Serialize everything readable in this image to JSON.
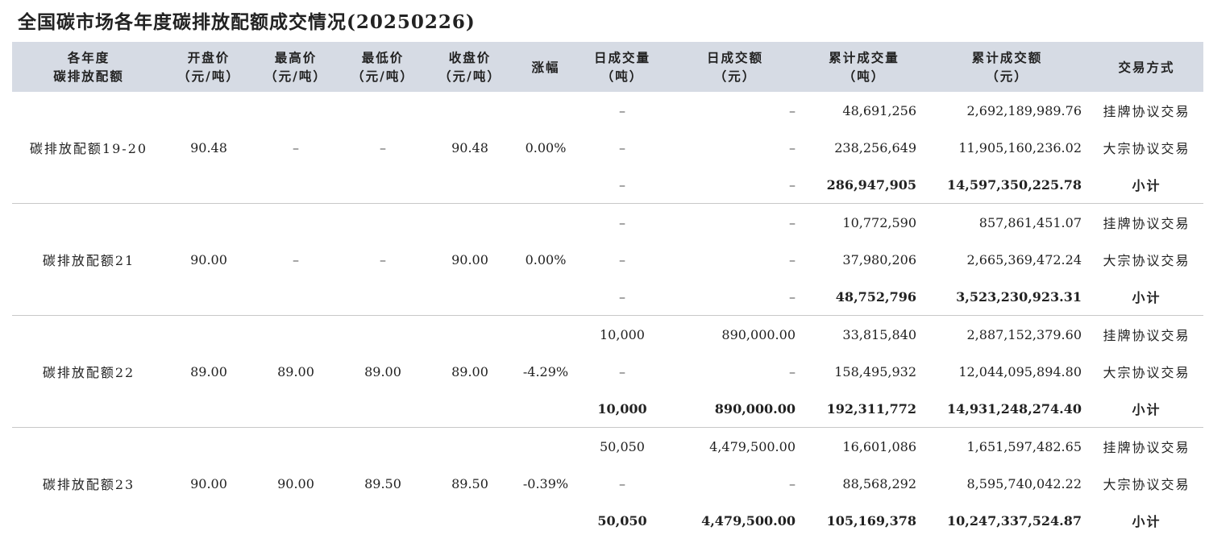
{
  "title": "全国碳市场各年度碳排放配额成交情况(20250226)",
  "headers": [
    {
      "line1": "各年度",
      "line2": "碳排放配额"
    },
    {
      "line1": "开盘价",
      "line2": "（元/吨）"
    },
    {
      "line1": "最高价",
      "line2": "（元/吨）"
    },
    {
      "line1": "最低价",
      "line2": "（元/吨）"
    },
    {
      "line1": "收盘价",
      "line2": "（元/吨）"
    },
    {
      "line1": "涨幅",
      "line2": ""
    },
    {
      "line1": "日成交量",
      "line2": "（吨）"
    },
    {
      "line1": "日成交额",
      "line2": "（元）"
    },
    {
      "line1": "累计成交量",
      "line2": "（吨）"
    },
    {
      "line1": "累计成交额",
      "line2": "（元）"
    },
    {
      "line1": "交易方式",
      "line2": ""
    }
  ],
  "groups": [
    {
      "name": "碳排放配额19-20",
      "open": "90.48",
      "high": "–",
      "low": "–",
      "close": "90.48",
      "change": "0.00%",
      "rows": [
        {
          "daily_vol": "–",
          "daily_amt": "–",
          "cum_vol": "48,691,256",
          "cum_amt": "2,692,189,989.76",
          "method": "挂牌协议交易"
        },
        {
          "daily_vol": "–",
          "daily_amt": "–",
          "cum_vol": "238,256,649",
          "cum_amt": "11,905,160,236.02",
          "method": "大宗协议交易"
        },
        {
          "daily_vol": "–",
          "daily_amt": "–",
          "cum_vol": "286,947,905",
          "cum_amt": "14,597,350,225.78",
          "method": "小计"
        }
      ]
    },
    {
      "name": "碳排放配额21",
      "open": "90.00",
      "high": "–",
      "low": "–",
      "close": "90.00",
      "change": "0.00%",
      "rows": [
        {
          "daily_vol": "–",
          "daily_amt": "–",
          "cum_vol": "10,772,590",
          "cum_amt": "857,861,451.07",
          "method": "挂牌协议交易"
        },
        {
          "daily_vol": "–",
          "daily_amt": "–",
          "cum_vol": "37,980,206",
          "cum_amt": "2,665,369,472.24",
          "method": "大宗协议交易"
        },
        {
          "daily_vol": "–",
          "daily_amt": "–",
          "cum_vol": "48,752,796",
          "cum_amt": "3,523,230,923.31",
          "method": "小计"
        }
      ]
    },
    {
      "name": "碳排放配额22",
      "open": "89.00",
      "high": "89.00",
      "low": "89.00",
      "close": "89.00",
      "change": "-4.29%",
      "rows": [
        {
          "daily_vol": "10,000",
          "daily_amt": "890,000.00",
          "cum_vol": "33,815,840",
          "cum_amt": "2,887,152,379.60",
          "method": "挂牌协议交易"
        },
        {
          "daily_vol": "–",
          "daily_amt": "–",
          "cum_vol": "158,495,932",
          "cum_amt": "12,044,095,894.80",
          "method": "大宗协议交易"
        },
        {
          "daily_vol": "10,000",
          "daily_amt": "890,000.00",
          "cum_vol": "192,311,772",
          "cum_amt": "14,931,248,274.40",
          "method": "小计"
        }
      ]
    },
    {
      "name": "碳排放配额23",
      "open": "90.00",
      "high": "90.00",
      "low": "89.50",
      "close": "89.50",
      "change": "-0.39%",
      "rows": [
        {
          "daily_vol": "50,050",
          "daily_amt": "4,479,500.00",
          "cum_vol": "16,601,086",
          "cum_amt": "1,651,597,482.65",
          "method": "挂牌协议交易"
        },
        {
          "daily_vol": "–",
          "daily_amt": "–",
          "cum_vol": "88,568,292",
          "cum_amt": "8,595,740,042.22",
          "method": "大宗协议交易"
        },
        {
          "daily_vol": "50,050",
          "daily_amt": "4,479,500.00",
          "cum_vol": "105,169,378",
          "cum_amt": "10,247,337,524.87",
          "method": "小计"
        }
      ]
    }
  ]
}
